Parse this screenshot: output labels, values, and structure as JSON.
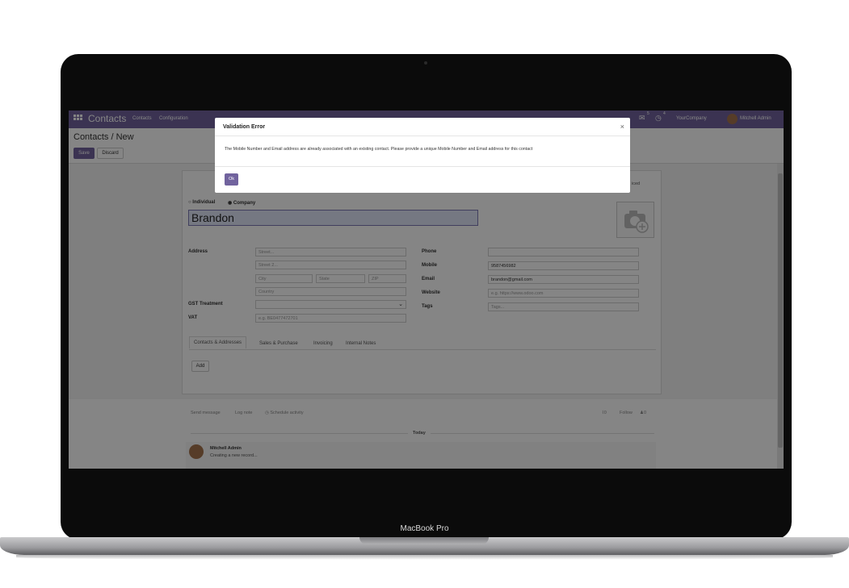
{
  "device": {
    "label": "MacBook Pro"
  },
  "navbar": {
    "app_title": "Contacts",
    "menu": [
      "Contacts",
      "Configuration"
    ],
    "messages_count": "5",
    "activities_count": "4",
    "company": "YourCompany",
    "user": "Mitchell Admin"
  },
  "control": {
    "breadcrumb": "Contacts / New",
    "save": "Save",
    "discard": "Discard"
  },
  "form": {
    "type_individual": "Individual",
    "type_company": "Company",
    "name": "Brandon",
    "address_label": "Address",
    "street_ph": "Street...",
    "street2_ph": "Street 2...",
    "city_ph": "City",
    "state_ph": "State",
    "zip_ph": "ZIP",
    "country_ph": "Country",
    "gst_label": "GST Treatment",
    "vat_label": "VAT",
    "vat_ph": "e.g. BE0477472701",
    "phone_label": "Phone",
    "mobile_label": "Mobile",
    "mobile_value": "9587456982",
    "email_label": "Email",
    "email_value": "brandon@gmail.com",
    "website_label": "Website",
    "website_ph": "e.g. https://www.odoo.com",
    "tags_label": "Tags",
    "tags_ph": "Tags...",
    "advanced_partial": "iced",
    "tabs": [
      "Contacts & Addresses",
      "Sales & Purchase",
      "Invoicing",
      "Internal Notes"
    ],
    "add_button": "Add"
  },
  "chatter": {
    "send_message": "Send message",
    "log_note": "Log note",
    "schedule": "Schedule activity",
    "attachments": "0",
    "follow": "Follow",
    "followers": "0",
    "today": "Today",
    "author": "Mitchell Admin",
    "message": "Creating a new record..."
  },
  "modal": {
    "title": "Validation Error",
    "close": "×",
    "body": "The Mobile Number and Email address are already associated with an existing contact. Please provide a unique Mobile Number and Email address for this contact",
    "ok": "Ok"
  },
  "colors": {
    "brand": "#71639e",
    "overlay": "rgba(0,0,0,0.48)"
  }
}
